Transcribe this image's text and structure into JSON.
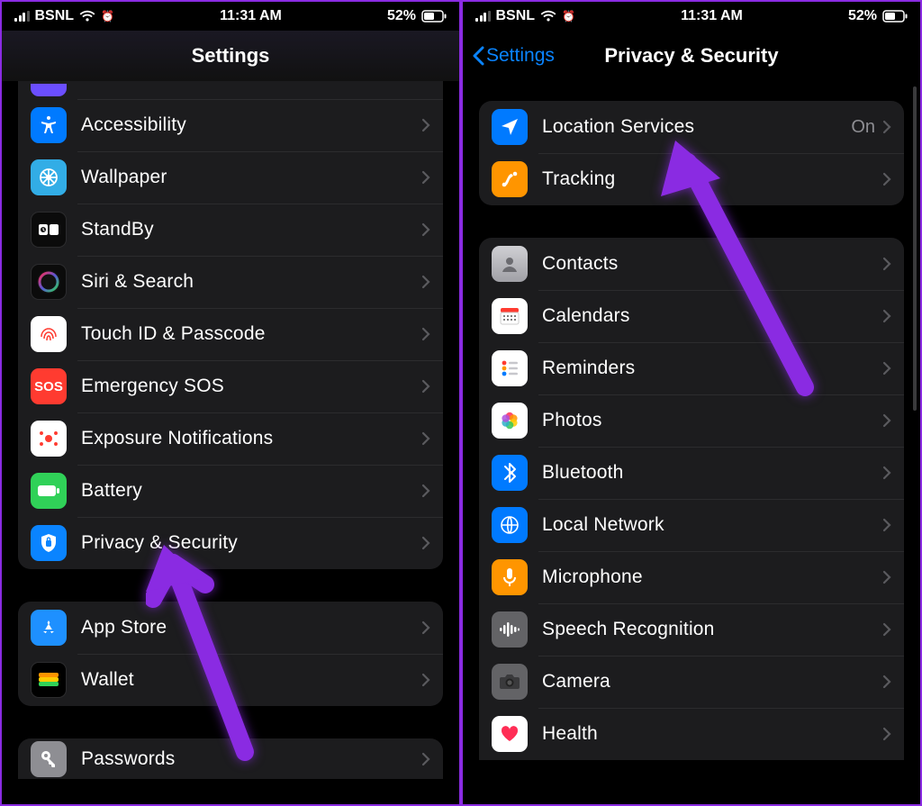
{
  "status": {
    "carrier": "BSNL",
    "time": "11:31 AM",
    "battery_text": "52%"
  },
  "left": {
    "title": "Settings",
    "groups": [
      [
        {
          "label": "Accessibility",
          "icon": "accessibility-icon",
          "bg": "bg-blue"
        },
        {
          "label": "Wallpaper",
          "icon": "wallpaper-icon",
          "bg": "bg-cyan"
        },
        {
          "label": "StandBy",
          "icon": "standby-icon",
          "bg": "bg-black"
        },
        {
          "label": "Siri & Search",
          "icon": "siri-icon",
          "bg": "bg-siri"
        },
        {
          "label": "Touch ID & Passcode",
          "icon": "touchid-icon",
          "bg": "bg-white"
        },
        {
          "label": "Emergency SOS",
          "icon": "sos-icon",
          "bg": "bg-red"
        },
        {
          "label": "Exposure Notifications",
          "icon": "exposure-icon",
          "bg": "bg-whiteexp"
        },
        {
          "label": "Battery",
          "icon": "battery-icon",
          "bg": "bg-green"
        },
        {
          "label": "Privacy & Security",
          "icon": "privacy-icon",
          "bg": "bg-blue2"
        }
      ],
      [
        {
          "label": "App Store",
          "icon": "appstore-icon",
          "bg": "bg-appstore"
        },
        {
          "label": "Wallet",
          "icon": "wallet-icon",
          "bg": "bg-wallet"
        }
      ],
      [
        {
          "label": "Passwords",
          "icon": "passwords-icon",
          "bg": "bg-gray"
        }
      ]
    ]
  },
  "right": {
    "back_label": "Settings",
    "title": "Privacy & Security",
    "groups": [
      [
        {
          "label": "Location Services",
          "value": "On",
          "icon": "location-icon",
          "bg": "bg-blue"
        },
        {
          "label": "Tracking",
          "icon": "tracking-icon",
          "bg": "bg-orange"
        }
      ],
      [
        {
          "label": "Contacts",
          "icon": "contacts-icon",
          "bg": "bg-grey2"
        },
        {
          "label": "Calendars",
          "icon": "calendar-icon",
          "bg": "bg-whitecal"
        },
        {
          "label": "Reminders",
          "icon": "reminders-icon",
          "bg": "bg-whitecal"
        },
        {
          "label": "Photos",
          "icon": "photos-icon",
          "bg": "bg-photos"
        },
        {
          "label": "Bluetooth",
          "icon": "bluetooth-icon",
          "bg": "bg-blue"
        },
        {
          "label": "Local Network",
          "icon": "localnetwork-icon",
          "bg": "bg-blglobe"
        },
        {
          "label": "Microphone",
          "icon": "microphone-icon",
          "bg": "bg-orange"
        },
        {
          "label": "Speech Recognition",
          "icon": "speech-icon",
          "bg": "bg-grey2"
        },
        {
          "label": "Camera",
          "icon": "camera-icon",
          "bg": "bg-grey2"
        },
        {
          "label": "Health",
          "icon": "health-icon",
          "bg": "bg-whitecal"
        }
      ]
    ]
  }
}
